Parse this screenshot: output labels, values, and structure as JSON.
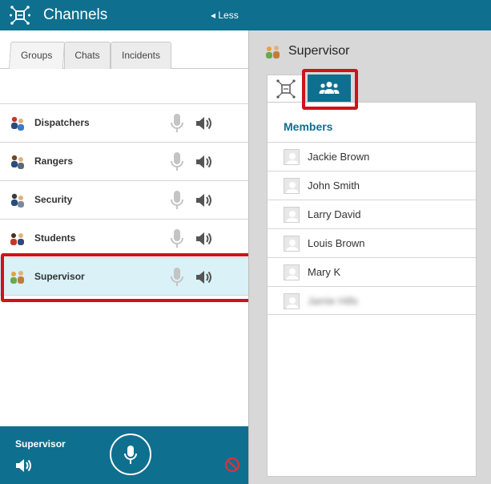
{
  "header": {
    "title": "Channels",
    "less_label": "◂ Less"
  },
  "tabs": [
    {
      "label": "Groups",
      "active": true
    },
    {
      "label": "Chats",
      "active": false
    },
    {
      "label": "Incidents",
      "active": false
    }
  ],
  "channels": [
    {
      "label": "Dispatchers",
      "selected": false
    },
    {
      "label": "Rangers",
      "selected": false
    },
    {
      "label": "Security",
      "selected": false
    },
    {
      "label": "Students",
      "selected": false
    },
    {
      "label": "Supervisor",
      "selected": true
    }
  ],
  "control_bar": {
    "channel_label": "Supervisor"
  },
  "right_panel": {
    "title": "Supervisor",
    "tabs": [
      {
        "icon": "channel-network-icon",
        "active": false
      },
      {
        "icon": "members-group-icon",
        "active": true
      }
    ],
    "members_title": "Members",
    "members": [
      {
        "name": "Jackie Brown"
      },
      {
        "name": "John Smith"
      },
      {
        "name": "Larry David"
      },
      {
        "name": "Louis Brown"
      },
      {
        "name": "Mary K"
      },
      {
        "name": "Jamie Hills"
      }
    ]
  },
  "colors": {
    "brand": "#0f6f8e",
    "selected_row": "#d9f1f7",
    "highlight": "#d0121b",
    "disabled_icon": "#bdbdbd",
    "block_icon": "#e0303a"
  }
}
